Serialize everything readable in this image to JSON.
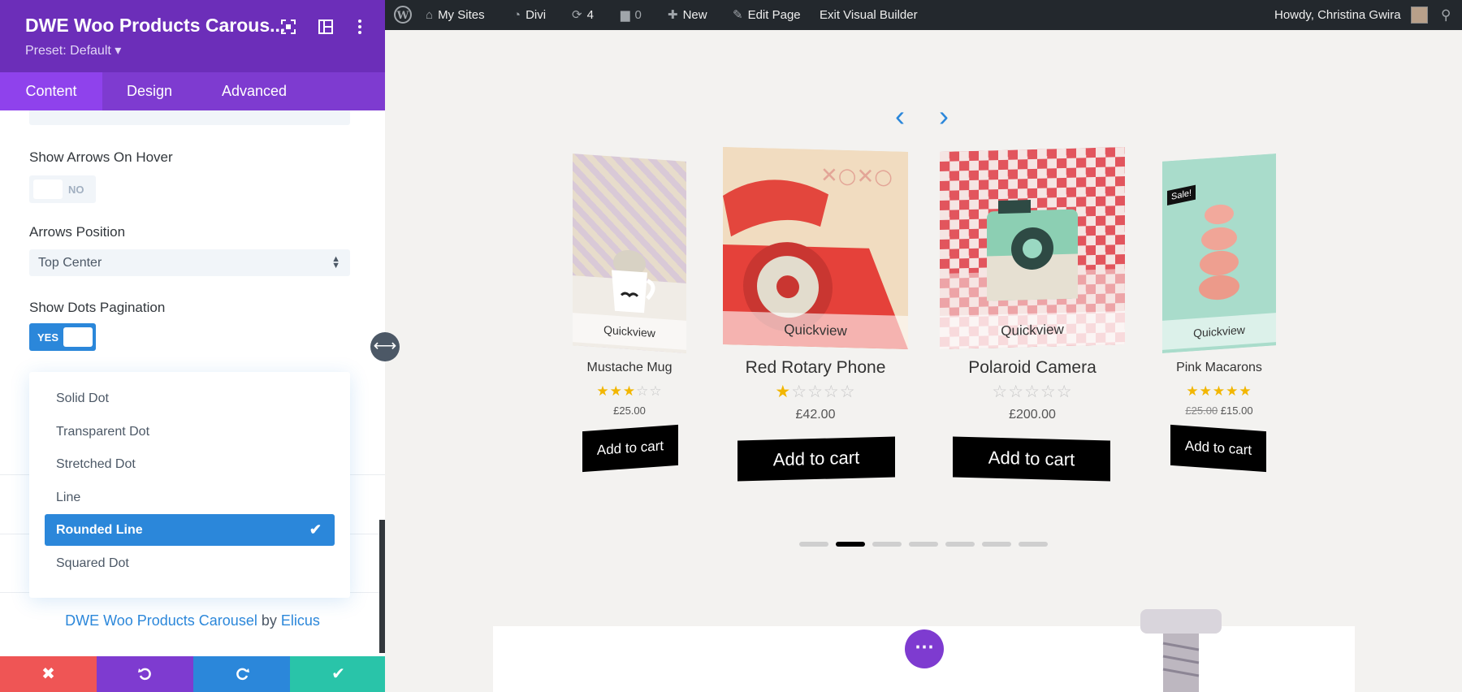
{
  "panel": {
    "title": "DWE Woo Products Carous...",
    "preset": "Preset: Default ▾",
    "tabs": [
      {
        "label": "Content",
        "active": true
      },
      {
        "label": "Design",
        "active": false
      },
      {
        "label": "Advanced",
        "active": false
      }
    ],
    "fields": {
      "show_arrows_on_hover": {
        "label": "Show Arrows On Hover",
        "value": "NO"
      },
      "arrows_position": {
        "label": "Arrows Position",
        "value": "Top Center"
      },
      "show_dots_pagination": {
        "label": "Show Dots Pagination",
        "value": "YES"
      }
    },
    "dots_style_options": [
      {
        "label": "Solid Dot",
        "selected": false
      },
      {
        "label": "Transparent Dot",
        "selected": false
      },
      {
        "label": "Stretched Dot",
        "selected": false
      },
      {
        "label": "Line",
        "selected": false
      },
      {
        "label": "Rounded Line",
        "selected": true
      },
      {
        "label": "Squared Dot",
        "selected": false
      }
    ],
    "credit": {
      "module": "DWE Woo Products Carousel",
      "by": "by",
      "author": "Elicus"
    },
    "footer_colors": {
      "discard": "#ef5555",
      "undo": "#7e3bd0",
      "redo": "#2b87da",
      "save": "#29c4a9"
    }
  },
  "adminbar": {
    "my_sites": "My Sites",
    "divi": "Divi",
    "updates_count": "4",
    "comments_count": "0",
    "new": "New",
    "edit_page": "Edit Page",
    "exit_builder": "Exit Visual Builder",
    "greeting": "Howdy, Christina Gwira"
  },
  "carousel": {
    "accent": "#2b87da",
    "products": [
      {
        "name": "Mustache Mug",
        "quickview": "Quickview",
        "rating": 3,
        "price": "£25.00",
        "old_price": "",
        "cta": "Add to cart",
        "sale": ""
      },
      {
        "name": "Red Rotary Phone",
        "quickview": "Quickview",
        "rating": 1,
        "price": "£42.00",
        "old_price": "",
        "cta": "Add to cart",
        "sale": ""
      },
      {
        "name": "Polaroid Camera",
        "quickview": "Quickview",
        "rating": 0,
        "price": "£200.00",
        "old_price": "",
        "cta": "Add to cart",
        "sale": ""
      },
      {
        "name": "Pink Macarons",
        "quickview": "Quickview",
        "rating": 5,
        "price": "£15.00",
        "old_price": "£25.00",
        "cta": "Add to cart",
        "sale": "Sale!"
      }
    ],
    "dots_total": 7,
    "dots_active_index": 1
  }
}
